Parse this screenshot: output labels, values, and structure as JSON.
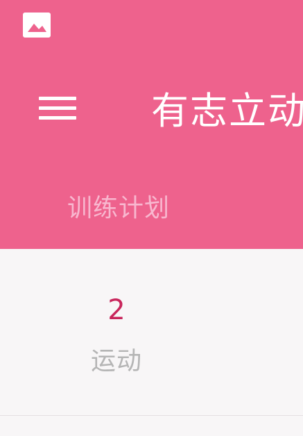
{
  "status_bar": {
    "icon": "image-icon"
  },
  "app_bar": {
    "menu_icon": "hamburger-menu-icon",
    "title": "有志立动",
    "subtitle": "训练计划"
  },
  "stats": {
    "count": "2",
    "label": "运动"
  },
  "colors": {
    "primary": "#ee628d",
    "accent": "#c8255b",
    "subtitle": "#f8b7cf",
    "muted_text": "#b5b5b5",
    "background": "#f8f6f7"
  }
}
